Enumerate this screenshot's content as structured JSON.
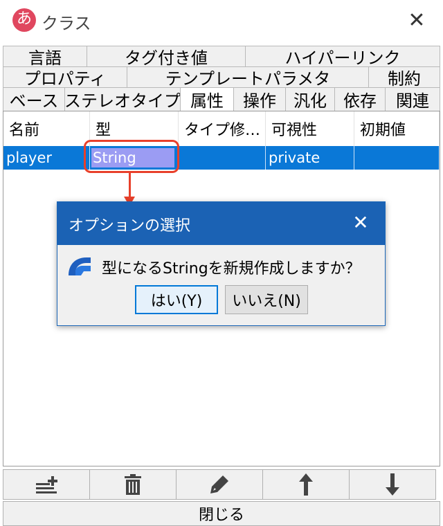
{
  "window": {
    "title": "クラス",
    "app_icon_glyph": "あ",
    "close_glyph": "✕"
  },
  "tabs": {
    "row1": [
      "言語",
      "タグ付き値",
      "ハイパーリンク"
    ],
    "row2": [
      "プロパティ",
      "テンプレートパラメタ",
      "制約"
    ],
    "row3": [
      "ベース",
      "ステレオタイプ",
      "属性",
      "操作",
      "汎化",
      "依存",
      "関連"
    ],
    "active": "属性"
  },
  "table": {
    "columns": [
      "名前",
      "型",
      "タイプ修…",
      "可視性",
      "初期値"
    ],
    "rows": [
      {
        "name": "player",
        "type": "String",
        "type_modifier": "",
        "visibility": "private",
        "initial_value": ""
      }
    ]
  },
  "dialog": {
    "title": "オプションの選択",
    "message": "型になるStringを新規作成しますか？",
    "yes_label": "はい(Y)",
    "no_label": "いいえ(N)",
    "close_glyph": "✕",
    "icon": "astah-logo-icon"
  },
  "toolbar": {
    "icons": [
      "add-row-icon",
      "trash-icon",
      "pen-icon",
      "arrow-up-icon",
      "arrow-down-icon"
    ]
  },
  "footer": {
    "close_label": "閉じる"
  },
  "colors": {
    "selection_blue": "#0a78d7",
    "dialog_title_blue": "#1b62b4",
    "highlight_red": "#e8402b"
  }
}
